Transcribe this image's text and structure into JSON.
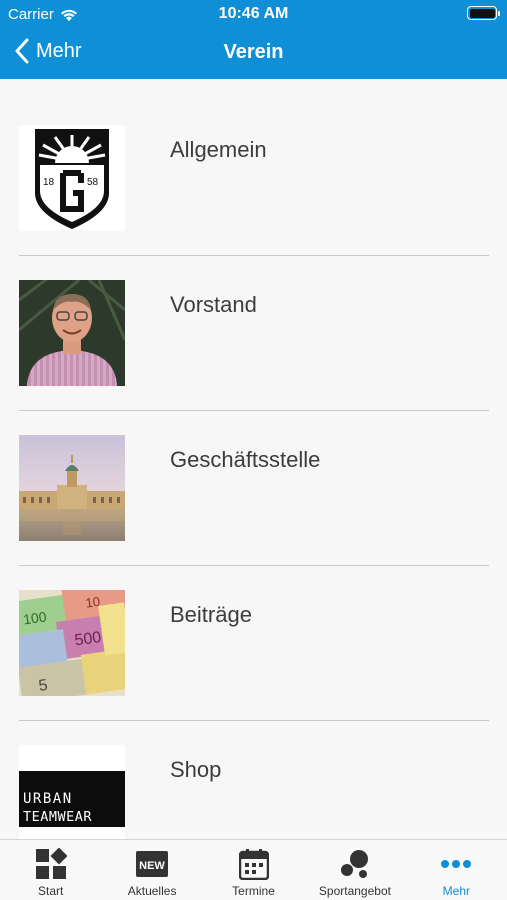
{
  "status_bar": {
    "carrier": "Carrier",
    "time": "10:46 AM"
  },
  "nav": {
    "back_label": "Mehr",
    "title": "Verein"
  },
  "list": {
    "items": [
      {
        "label": "Allgemein",
        "thumb": "club-crest",
        "crest_left": "18",
        "crest_right": "58"
      },
      {
        "label": "Vorstand",
        "thumb": "person-photo"
      },
      {
        "label": "Geschäftsstelle",
        "thumb": "palace-photo"
      },
      {
        "label": "Beiträge",
        "thumb": "banknotes-photo"
      },
      {
        "label": "Shop",
        "thumb": "brand-logo",
        "logo_line1": "URBAN",
        "logo_line2": "TEAMWEAR"
      }
    ]
  },
  "tabbar": {
    "active": "Mehr",
    "active_color": "#0f8fd6",
    "tabs": [
      {
        "label": "Start",
        "icon": "dashboard-icon"
      },
      {
        "label": "Aktuelles",
        "icon": "news-icon",
        "badge": "NEW"
      },
      {
        "label": "Termine",
        "icon": "calendar-icon"
      },
      {
        "label": "Sportangebot",
        "icon": "sports-icon"
      },
      {
        "label": "Mehr",
        "icon": "more-dots-icon"
      }
    ]
  },
  "colors": {
    "header": "#0f8fd6",
    "background": "#f7f7f7",
    "divider": "#c8c8c8"
  }
}
